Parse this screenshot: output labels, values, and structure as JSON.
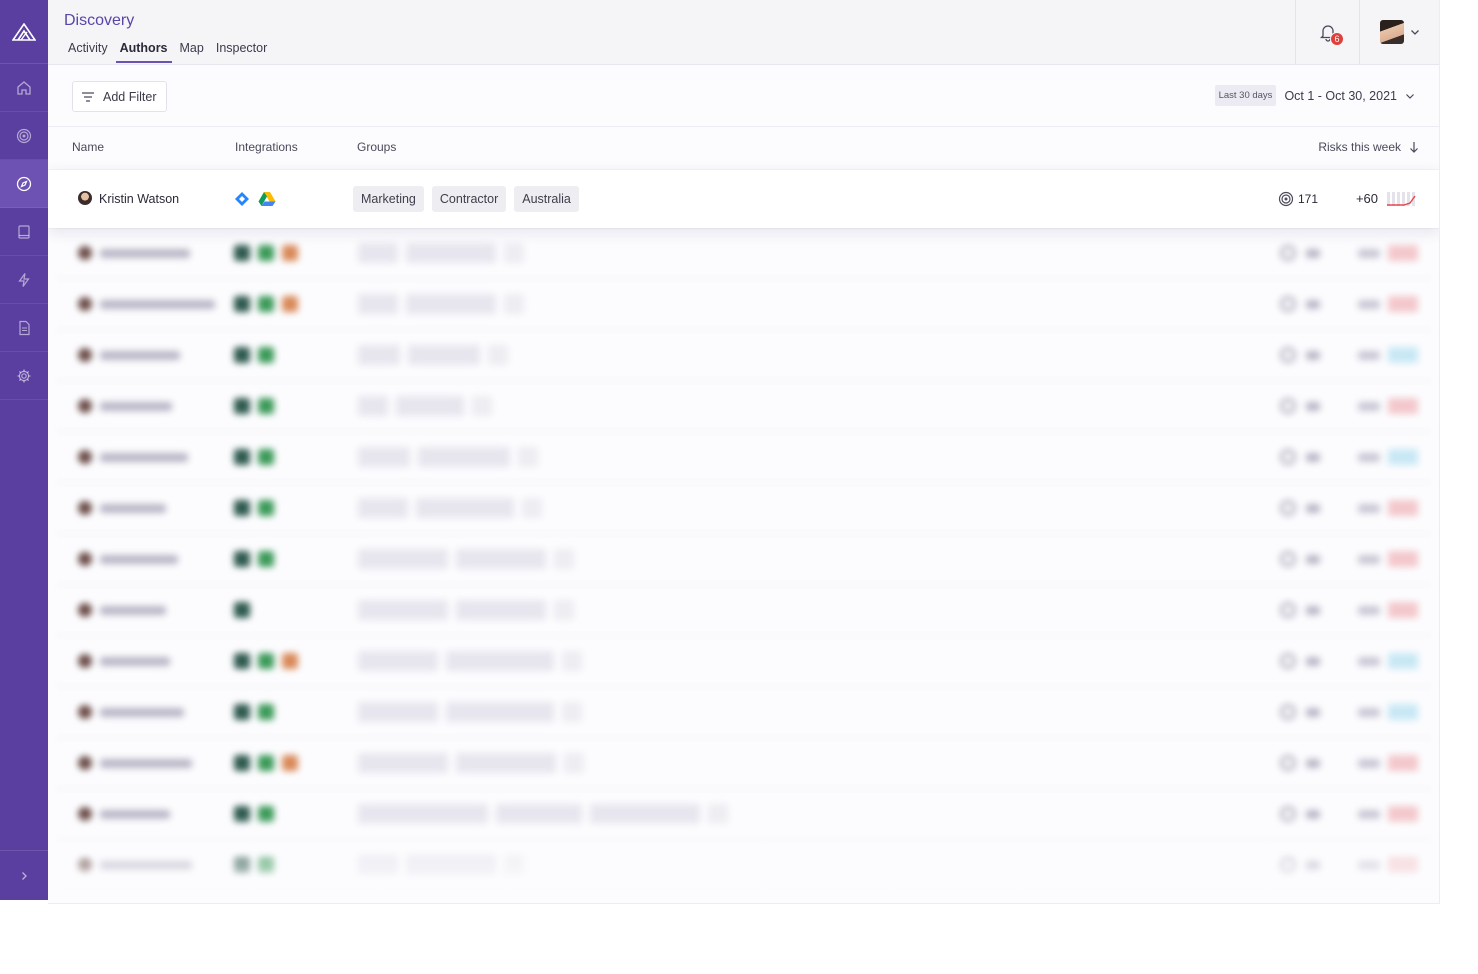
{
  "header": {
    "title": "Discovery",
    "tabs": [
      {
        "label": "Activity",
        "active": false
      },
      {
        "label": "Authors",
        "active": true
      },
      {
        "label": "Map",
        "active": false
      },
      {
        "label": "Inspector",
        "active": false
      }
    ],
    "notification_count": "6"
  },
  "sidebar": {
    "items": [
      {
        "icon": "home-icon"
      },
      {
        "icon": "target-icon"
      },
      {
        "icon": "compass-icon",
        "active": true
      },
      {
        "icon": "book-icon"
      },
      {
        "icon": "lightning-icon"
      },
      {
        "icon": "document-icon"
      },
      {
        "icon": "gear-icon"
      }
    ]
  },
  "filters": {
    "add_filter_label": "Add Filter",
    "date_chip": "Last 30 days",
    "date_range": "Oct 1 - Oct 30, 2021"
  },
  "table": {
    "columns": {
      "name": "Name",
      "integrations": "Integrations",
      "groups": "Groups",
      "risks": "Risks this week"
    },
    "highlighted_row": {
      "name": "Kristin Watson",
      "integrations": [
        "jira-icon",
        "google-drive-icon"
      ],
      "groups": [
        "Marketing",
        "Contractor",
        "Australia"
      ],
      "risk_count": "171",
      "risk_delta": "+60"
    },
    "blurred_rows_count": 13
  },
  "colors": {
    "sidebar": "#5b3fa0",
    "accent": "#6a52b3",
    "title": "#5a45a6",
    "badge": "#e0403a"
  }
}
